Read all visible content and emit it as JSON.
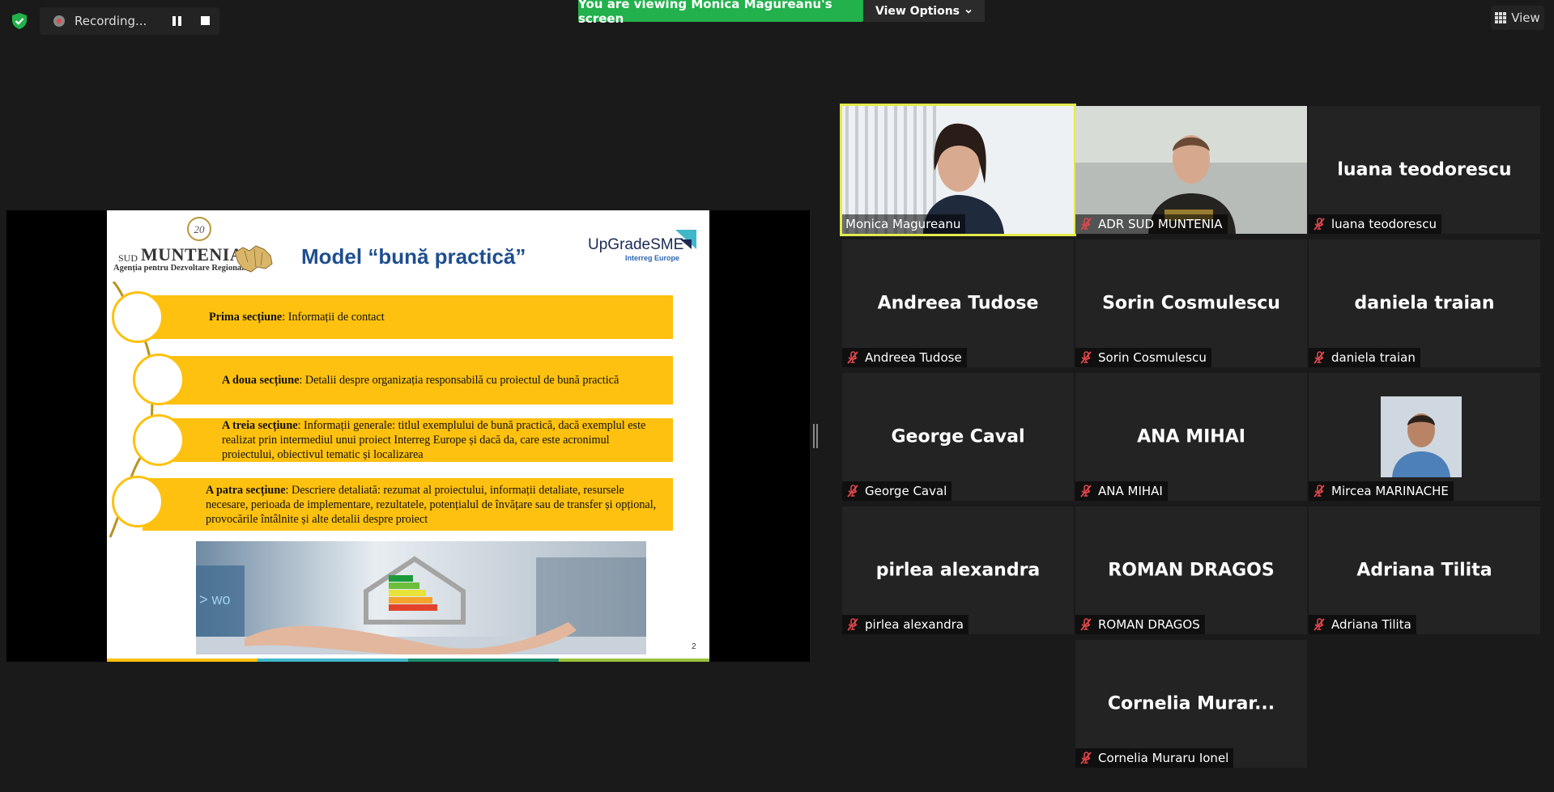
{
  "toolbar": {
    "recording_label": "Recording...",
    "sharing_banner": "You are viewing Monica Magureanu's screen",
    "view_options_label": "View Options",
    "view_label": "View"
  },
  "slide": {
    "logo_left": {
      "badge": "20",
      "sud": "SUD",
      "muntenia": "MUNTENIA",
      "agency": "Agenția pentru Dezvoltare Regională"
    },
    "title": "Model “bună practică”",
    "logo_right": {
      "name": "UpGradeSME",
      "sub": "Interreg Europe"
    },
    "sections": [
      {
        "heading": "Prima secțiune",
        "text": ": Informații de contact"
      },
      {
        "heading": "A doua secțiune",
        "text": ": Detalii despre organizația responsabilă cu proiectul de bună practică"
      },
      {
        "heading": "A treia secțiune",
        "text": ": Informații generale: titlul exemplului de bună practică, dacă exemplul este realizat prin intermediul unui proiect Interreg Europe și dacă da, care este acronimul proiectului, obiectivul tematic și localizarea"
      },
      {
        "heading": "A patra secțiune",
        "text": ": Descriere detaliată: rezumat al proiectului, informații detaliate, resursele necesare, perioada de implementare, rezultatele, potențialul de învățare sau de transfer și opțional, provocările întâlnite și alte detalii despre proiect"
      }
    ],
    "page_number": "2",
    "photo_overlay_text": "> wo"
  },
  "participants": [
    {
      "big": "",
      "name": "Monica Magureanu",
      "muted": false,
      "video": "monica"
    },
    {
      "big": "",
      "name": "ADR SUD MUNTENIA",
      "muted": true,
      "video": "adr"
    },
    {
      "big": "luana teodorescu",
      "name": "luana teodorescu",
      "muted": true
    },
    {
      "big": "Andreea Tudose",
      "name": "Andreea Tudose",
      "muted": true
    },
    {
      "big": "Sorin Cosmulescu",
      "name": "Sorin Cosmulescu",
      "muted": true
    },
    {
      "big": "daniela traian",
      "name": "daniela traian",
      "muted": true
    },
    {
      "big": "George Caval",
      "name": "George Caval",
      "muted": true
    },
    {
      "big": "ANA MIHAI",
      "name": "ANA MIHAI",
      "muted": true
    },
    {
      "big": "",
      "name": "Mircea MARINACHE",
      "muted": true,
      "video": "avatar"
    },
    {
      "big": "pirlea alexandra",
      "name": "pirlea alexandra",
      "muted": true
    },
    {
      "big": "ROMAN DRAGOS",
      "name": "ROMAN DRAGOS",
      "muted": true
    },
    {
      "big": "Adriana Tilita",
      "name": "Adriana Tilita",
      "muted": true
    },
    {
      "big": "Cornelia  Murar...",
      "name": "Cornelia Muraru Ionel",
      "muted": true
    }
  ],
  "colors": {
    "banner_green": "#22b14c",
    "active_speaker": "#e3ea4d",
    "muted_red": "#e0474c",
    "slide_yellow": "#fec10f",
    "slide_title_blue": "#1f4e8f"
  }
}
